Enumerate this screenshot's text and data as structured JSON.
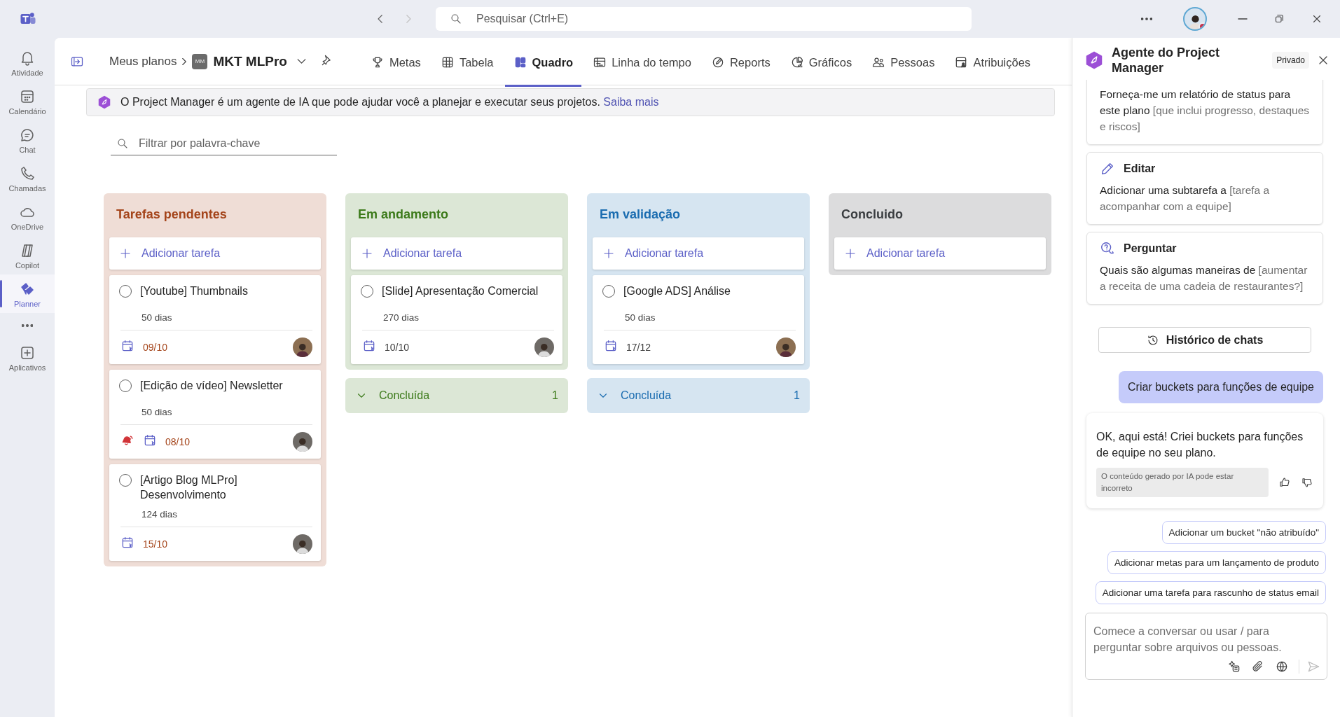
{
  "topbar": {
    "search_placeholder": "Pesquisar (Ctrl+E)"
  },
  "rail": [
    {
      "kind": "app",
      "label": "Atividade",
      "selected": false
    },
    {
      "kind": "app",
      "label": "Calendário",
      "selected": false
    },
    {
      "kind": "app",
      "label": "Chat",
      "selected": false
    },
    {
      "kind": "app",
      "label": "Chamadas",
      "selected": false
    },
    {
      "kind": "app",
      "label": "OneDrive",
      "selected": false
    },
    {
      "kind": "app",
      "label": "Copilot",
      "selected": false
    },
    {
      "kind": "app",
      "label": "Planner",
      "selected": true
    },
    {
      "kind": "more"
    },
    {
      "kind": "app",
      "label": "Aplicativos",
      "selected": false
    }
  ],
  "breadcrumb": {
    "root": "Meus planos",
    "plan_initials": "MM",
    "plan": "MKT MLPro"
  },
  "tabs": [
    {
      "label": "Metas",
      "selected": false
    },
    {
      "label": "Tabela",
      "selected": false
    },
    {
      "label": "Quadro",
      "selected": true
    },
    {
      "label": "Linha do tempo",
      "selected": false
    },
    {
      "label": "Reports",
      "selected": false
    },
    {
      "label": "Gráficos",
      "selected": false
    },
    {
      "label": "Pessoas",
      "selected": false
    },
    {
      "label": "Atribuições",
      "selected": false
    }
  ],
  "banner": {
    "text": "O Project Manager é um agente de IA que pode ajudar você a planejar e executar seus projetos.",
    "link": "Saiba mais"
  },
  "filter": {
    "placeholder": "Filtrar por palavra-chave"
  },
  "buckets": [
    {
      "title": "Tarefas pendentes",
      "color": "#a4441a",
      "add_label": "Adicionar tarefa",
      "tasks": [
        {
          "title": "[Youtube] Thumbnails",
          "duration": "50 dias",
          "due": "09/10",
          "overdue": true,
          "urgent": false
        },
        {
          "title": "[Edição de vídeo] Newsletter",
          "duration": "50 dias",
          "due": "08/10",
          "overdue": true,
          "urgent": true
        },
        {
          "title": "[Artigo Blog MLPro] Desenvolvimento",
          "duration": "124 dias",
          "due": "15/10",
          "overdue": true,
          "urgent": false
        }
      ]
    },
    {
      "title": "Em andamento",
      "color": "#3c7a1a",
      "add_label": "Adicionar tarefa",
      "tasks": [
        {
          "title": "[Slide] Apresentação Comercial",
          "duration": "270 dias",
          "due": "10/10",
          "overdue": false,
          "urgent": false
        }
      ],
      "completed": {
        "label": "Concluída",
        "count": "1"
      }
    },
    {
      "title": "Em validação",
      "color": "#1a6cb0",
      "add_label": "Adicionar tarefa",
      "tasks": [
        {
          "title": "[Google ADS] Análise",
          "duration": "50 dias",
          "due": "17/12",
          "overdue": false,
          "urgent": false
        }
      ],
      "completed": {
        "label": "Concluída",
        "count": "1"
      }
    },
    {
      "title": "Concluido",
      "color": "#3a3d40",
      "add_label": "Adicionar tarefa"
    }
  ],
  "agent": {
    "title": "Agente do Project Manager",
    "badge": "Privado",
    "prompts": [
      {
        "text": "Forneça-me um relatório de status para este plano",
        "hint": "[que inclui progresso, destaques e riscos]"
      },
      {
        "heading": "Editar",
        "text": "Adicionar uma subtarefa a",
        "hint": "[tarefa a acompanhar com a equipe]"
      },
      {
        "heading": "Perguntar",
        "text": "Quais são algumas maneiras de",
        "hint": "[aumentar a receita de uma cadeia de restaurantes?]"
      }
    ],
    "history_button": "Histórico de chats",
    "user_message": "Criar buckets para funções de equipe",
    "reply": {
      "text": "OK, aqui está! Criei buckets para funções de equipe no seu plano.",
      "disclaimer": "O conteúdo gerado por IA pode estar incorreto"
    },
    "suggestions": [
      "Adicionar um bucket \"não atribuído\"",
      "Adicionar metas para um lançamento de produto",
      "Adicionar uma tarefa para rascunho de status email"
    ],
    "composer": {
      "placeholder": "Comece a conversar ou usar / para perguntar sobre arquivos ou pessoas."
    }
  }
}
